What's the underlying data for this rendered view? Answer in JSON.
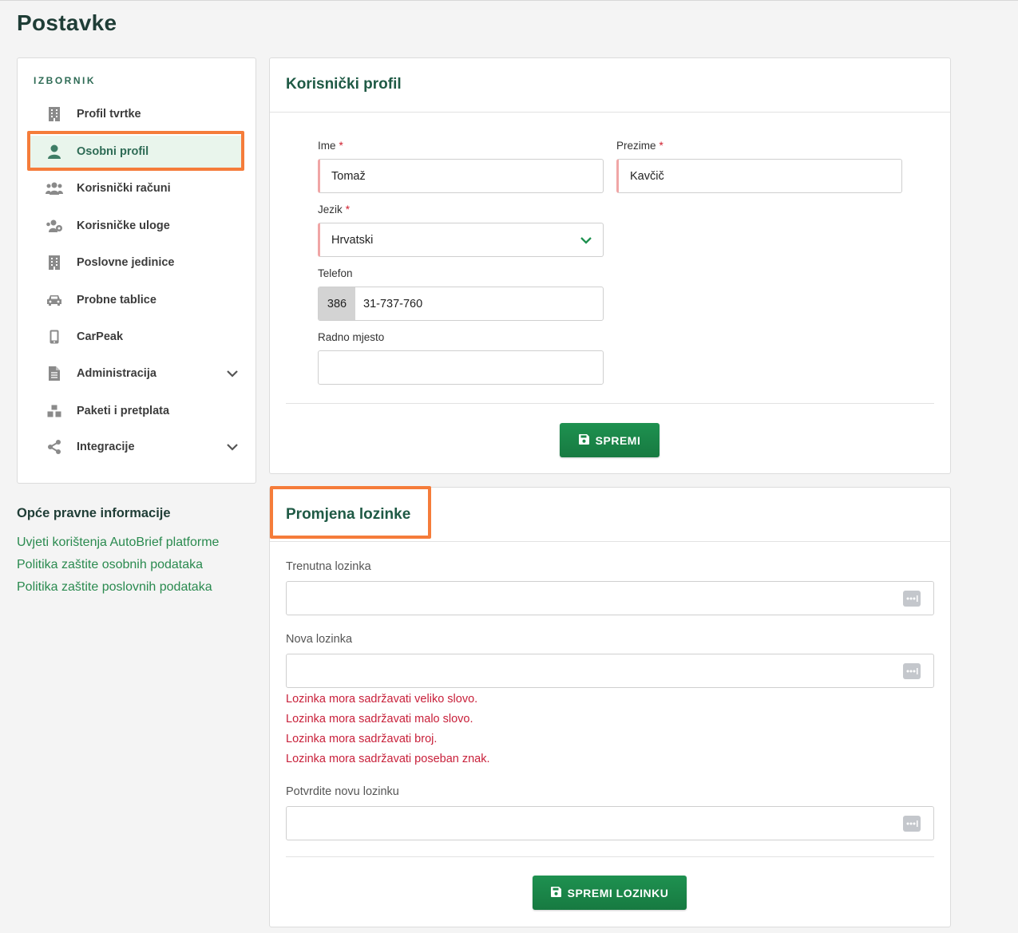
{
  "page": {
    "title": "Postavke"
  },
  "sidebar": {
    "heading": "IZBORNIK",
    "items": [
      {
        "label": "Profil tvrtke",
        "icon": "building-icon"
      },
      {
        "label": "Osobni profil",
        "icon": "user-icon",
        "active": true
      },
      {
        "label": "Korisnički računi",
        "icon": "users-icon"
      },
      {
        "label": "Korisničke uloge",
        "icon": "user-roles-icon"
      },
      {
        "label": "Poslovne jedinice",
        "icon": "building-icon"
      },
      {
        "label": "Probne tablice",
        "icon": "car-icon"
      },
      {
        "label": "CarPeak",
        "icon": "mobile-icon"
      },
      {
        "label": "Administracija",
        "icon": "document-icon",
        "expandable": true
      },
      {
        "label": "Paketi i pretplata",
        "icon": "boxes-icon"
      },
      {
        "label": "Integracije",
        "icon": "share-icon",
        "expandable": true
      }
    ]
  },
  "legal": {
    "title": "Opće pravne informacije",
    "links": [
      "Uvjeti korištenja AutoBrief platforme",
      "Politika zaštite osobnih podataka",
      "Politika zaštite poslovnih podataka"
    ]
  },
  "profile": {
    "title": "Korisnički profil",
    "first_name": {
      "label": "Ime",
      "required_mark": "*",
      "value": "Tomaž"
    },
    "last_name": {
      "label": "Prezime",
      "required_mark": "*",
      "value": "Kavčič"
    },
    "language": {
      "label": "Jezik",
      "required_mark": "*",
      "value": "Hrvatski"
    },
    "phone": {
      "label": "Telefon",
      "prefix": "386",
      "value": "31-737-760"
    },
    "job": {
      "label": "Radno mjesto",
      "value": ""
    },
    "save_label": "SPREMI"
  },
  "password": {
    "title": "Promjena lozinke",
    "current_label": "Trenutna lozinka",
    "new_label": "Nova lozinka",
    "errors": [
      "Lozinka mora sadržavati veliko slovo.",
      "Lozinka mora sadržavati malo slovo.",
      "Lozinka mora sadržavati broj.",
      "Lozinka mora sadržavati poseban znak."
    ],
    "confirm_label": "Potvrdite novu lozinku",
    "save_label": "SPREMI LOZINKU"
  },
  "colors": {
    "accent": "#2e6b55",
    "button": "#1a8748",
    "highlight": "#f57c3a",
    "error": "#c8203a"
  }
}
